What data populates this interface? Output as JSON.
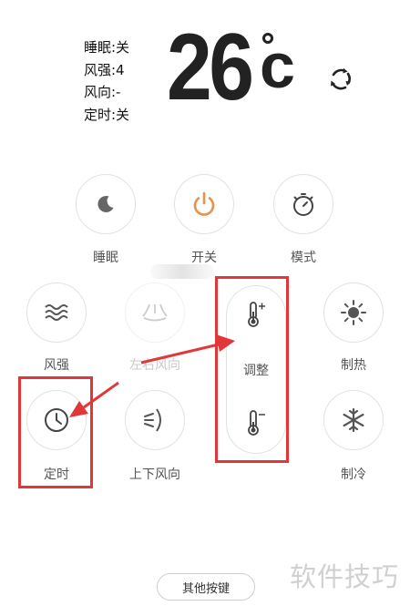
{
  "status": {
    "sleep": "睡眠:关",
    "fan_strength": "风强:4",
    "fan_direction": "风向:-",
    "timer": "定时:关"
  },
  "temperature": {
    "value": "26",
    "unit": "c"
  },
  "buttons": {
    "sleep": "睡眠",
    "power": "开关",
    "mode": "模式",
    "fan_strength": "风强",
    "swing_lr": "左右风向",
    "adjust": "调整",
    "heat": "制热",
    "timer": "定时",
    "swing_ud": "上下风向",
    "cool": "制冷"
  },
  "other_keys": "其他按键",
  "watermark": "软件技巧",
  "colors": {
    "power_accent": "#e8904a",
    "highlight_red": "#e0383a",
    "icon_gray": "#666666"
  },
  "icons": [
    "moon-icon",
    "power-icon",
    "timer-mode-icon",
    "wind-icon",
    "swing-lr-icon",
    "temp-up-icon",
    "temp-down-icon",
    "sun-icon",
    "clock-icon",
    "swing-ud-icon",
    "snowflake-icon",
    "refresh-icon"
  ]
}
